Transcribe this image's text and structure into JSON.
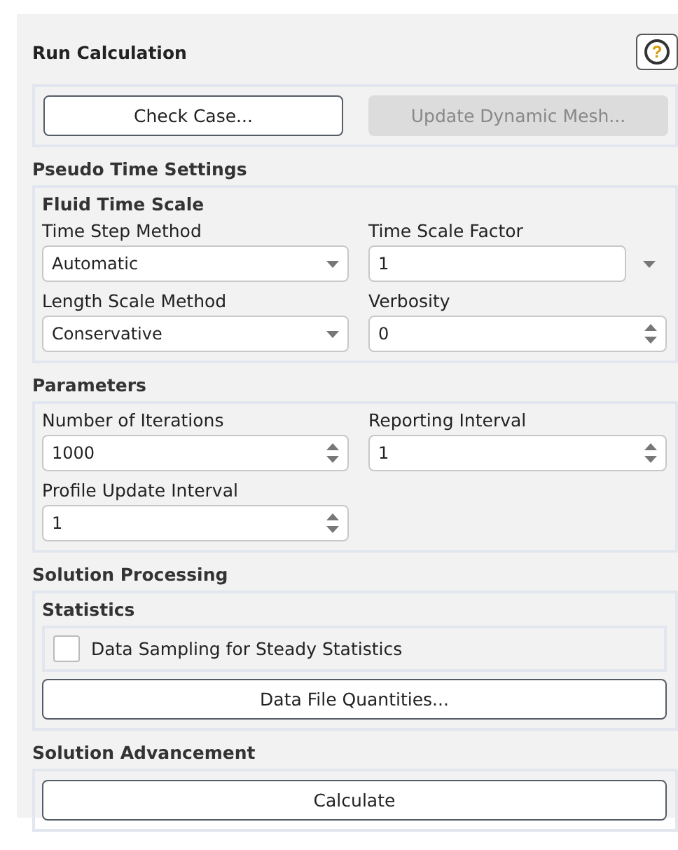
{
  "panel": {
    "title": "Run Calculation",
    "help": "?"
  },
  "top_buttons": [
    {
      "label": "Check Case...",
      "disabled": false
    },
    {
      "label": "Update Dynamic Mesh...",
      "disabled": true
    }
  ],
  "sections": [
    {
      "title": "Pseudo Time Settings",
      "items": [
        {
          "kind": "group",
          "title": "Fluid Time Scale",
          "fields": [
            {
              "label": "Time Step Method",
              "kind": "dropdown",
              "value": "Automatic"
            },
            {
              "label": "Time Scale Factor",
              "kind": "combo",
              "value": "1"
            },
            {
              "label": "Length Scale Method",
              "kind": "dropdown",
              "value": "Conservative"
            },
            {
              "label": "Verbosity",
              "kind": "spinner",
              "value": "0"
            }
          ]
        }
      ]
    },
    {
      "title": "Parameters",
      "items": [
        {
          "kind": "fields",
          "fields": [
            {
              "label": "Number of Iterations",
              "kind": "spinner",
              "value": "1000"
            },
            {
              "label": "Reporting Interval",
              "kind": "spinner",
              "value": "1"
            },
            {
              "label": "Profile Update Interval",
              "kind": "spinner",
              "value": "1"
            }
          ]
        }
      ]
    },
    {
      "title": "Solution Processing",
      "items": [
        {
          "kind": "group",
          "title": "Statistics",
          "children": [
            {
              "kind": "checkbox",
              "label": "Data Sampling for Steady Statistics",
              "checked": false
            },
            {
              "kind": "button",
              "label": "Data File Quantities..."
            }
          ]
        }
      ]
    },
    {
      "title": "Solution Advancement",
      "items": [
        {
          "kind": "buttonbox",
          "label": "Calculate"
        }
      ]
    }
  ]
}
